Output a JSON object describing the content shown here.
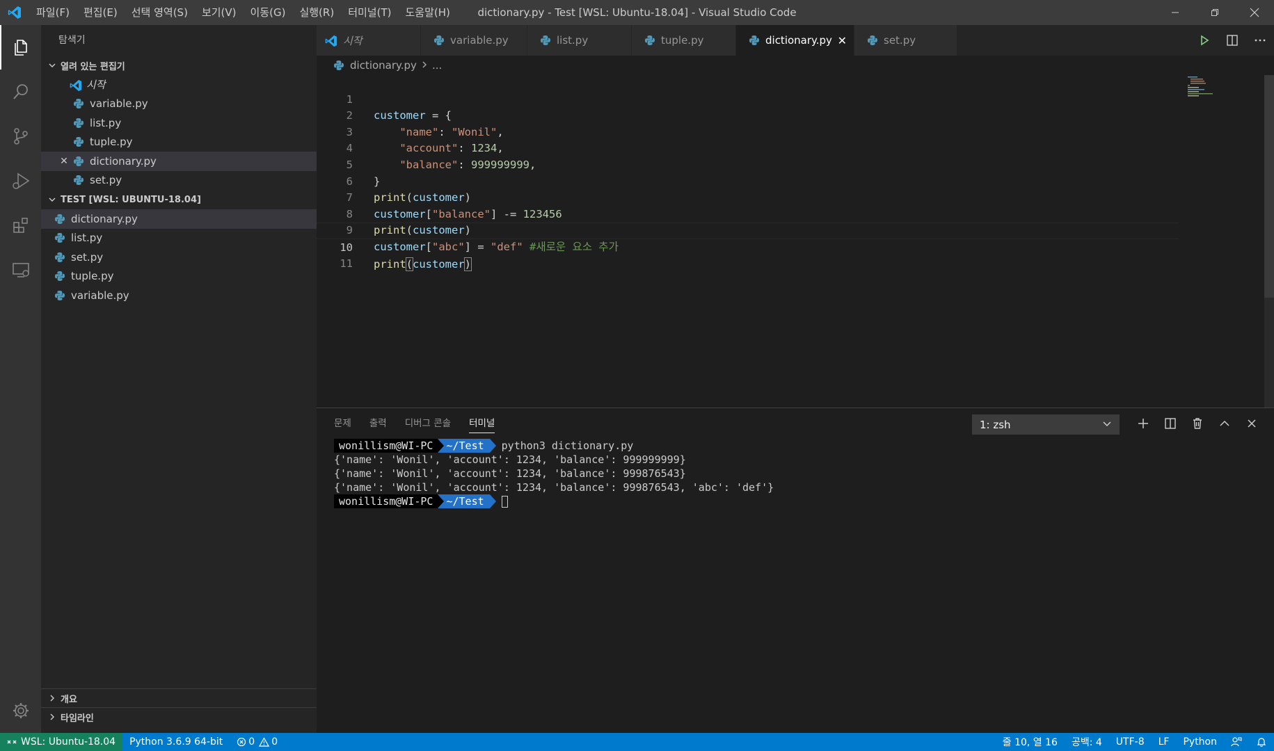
{
  "window": {
    "title": "dictionary.py - Test [WSL: Ubuntu-18.04] - Visual Studio Code",
    "menu": [
      "파일(F)",
      "편집(E)",
      "선택 영역(S)",
      "보기(V)",
      "이동(G)",
      "실행(R)",
      "터미널(T)",
      "도움말(H)"
    ]
  },
  "sidebar": {
    "title": "탐색기",
    "open_editors_header": "열려 있는 편집기",
    "open_editors": [
      "시작",
      "variable.py",
      "list.py",
      "tuple.py",
      "dictionary.py",
      "set.py"
    ],
    "folder_header": "TEST [WSL: UBUNTU-18.04]",
    "files": [
      "dictionary.py",
      "list.py",
      "set.py",
      "tuple.py",
      "variable.py"
    ],
    "outline_header": "개요",
    "timeline_header": "타임라인"
  },
  "tabs": [
    "시작",
    "variable.py",
    "list.py",
    "tuple.py",
    "dictionary.py",
    "set.py"
  ],
  "breadcrumb": {
    "file": "dictionary.py",
    "rest": "..."
  },
  "editor": {
    "line_numbers": [
      "1",
      "2",
      "3",
      "4",
      "5",
      "6",
      "7",
      "8",
      "9",
      "10",
      "11"
    ],
    "lines": {
      "l1": {
        "a": "customer",
        "b": " = {"
      },
      "l2": {
        "indent": "    ",
        "k": "\"name\"",
        "c": ": ",
        "v": "\"Wonil\"",
        "e": ","
      },
      "l3": {
        "indent": "    ",
        "k": "\"account\"",
        "c": ": ",
        "v": "1234",
        "e": ","
      },
      "l4": {
        "indent": "    ",
        "k": "\"balance\"",
        "c": ": ",
        "v": "999999999",
        "e": ","
      },
      "l5": {
        "a": "}"
      },
      "l6": {
        "fn": "print",
        "o": "(",
        "v": "customer",
        "c": ")"
      },
      "l7": {
        "v": "customer",
        "o": "[",
        "s": "\"balance\"",
        "c": "] -= ",
        "n": "123456"
      },
      "l8": {
        "fn": "print",
        "o": "(",
        "v": "customer",
        "c": ")"
      },
      "l9": {
        "v": "customer",
        "o": "[",
        "s": "\"abc\"",
        "c": "] = ",
        "s2": "\"def\"",
        "sp": " ",
        "cm": "#새로운 요소 추가"
      },
      "l10": {
        "fn": "print",
        "o": "(",
        "v": "customer",
        "c": ")"
      }
    }
  },
  "panel": {
    "tabs": [
      "문제",
      "출력",
      "디버그 콘솔",
      "터미널"
    ],
    "terminal_select": "1: zsh"
  },
  "terminal": {
    "user": "wonillism@WI-PC",
    "path": "~/Test",
    "command": "python3 dictionary.py",
    "output": [
      "{'name': 'Wonil', 'account': 1234, 'balance': 999999999}",
      "{'name': 'Wonil', 'account': 1234, 'balance': 999876543}",
      "{'name': 'Wonil', 'account': 1234, 'balance': 999876543, 'abc': 'def'}"
    ]
  },
  "statusbar": {
    "remote": "WSL: Ubuntu-18.04",
    "interpreter": "Python 3.6.9 64-bit",
    "errors": "0",
    "warnings": "0",
    "position": "줄 10, 열 16",
    "spaces": "공백: 4",
    "encoding": "UTF-8",
    "eol": "LF",
    "language": "Python"
  },
  "colors": {
    "accent": "#007acc",
    "remote": "#16825d",
    "titlebar": "#3c3c3c",
    "editor_bg": "#1e1e1e",
    "sidebar_bg": "#252526"
  }
}
